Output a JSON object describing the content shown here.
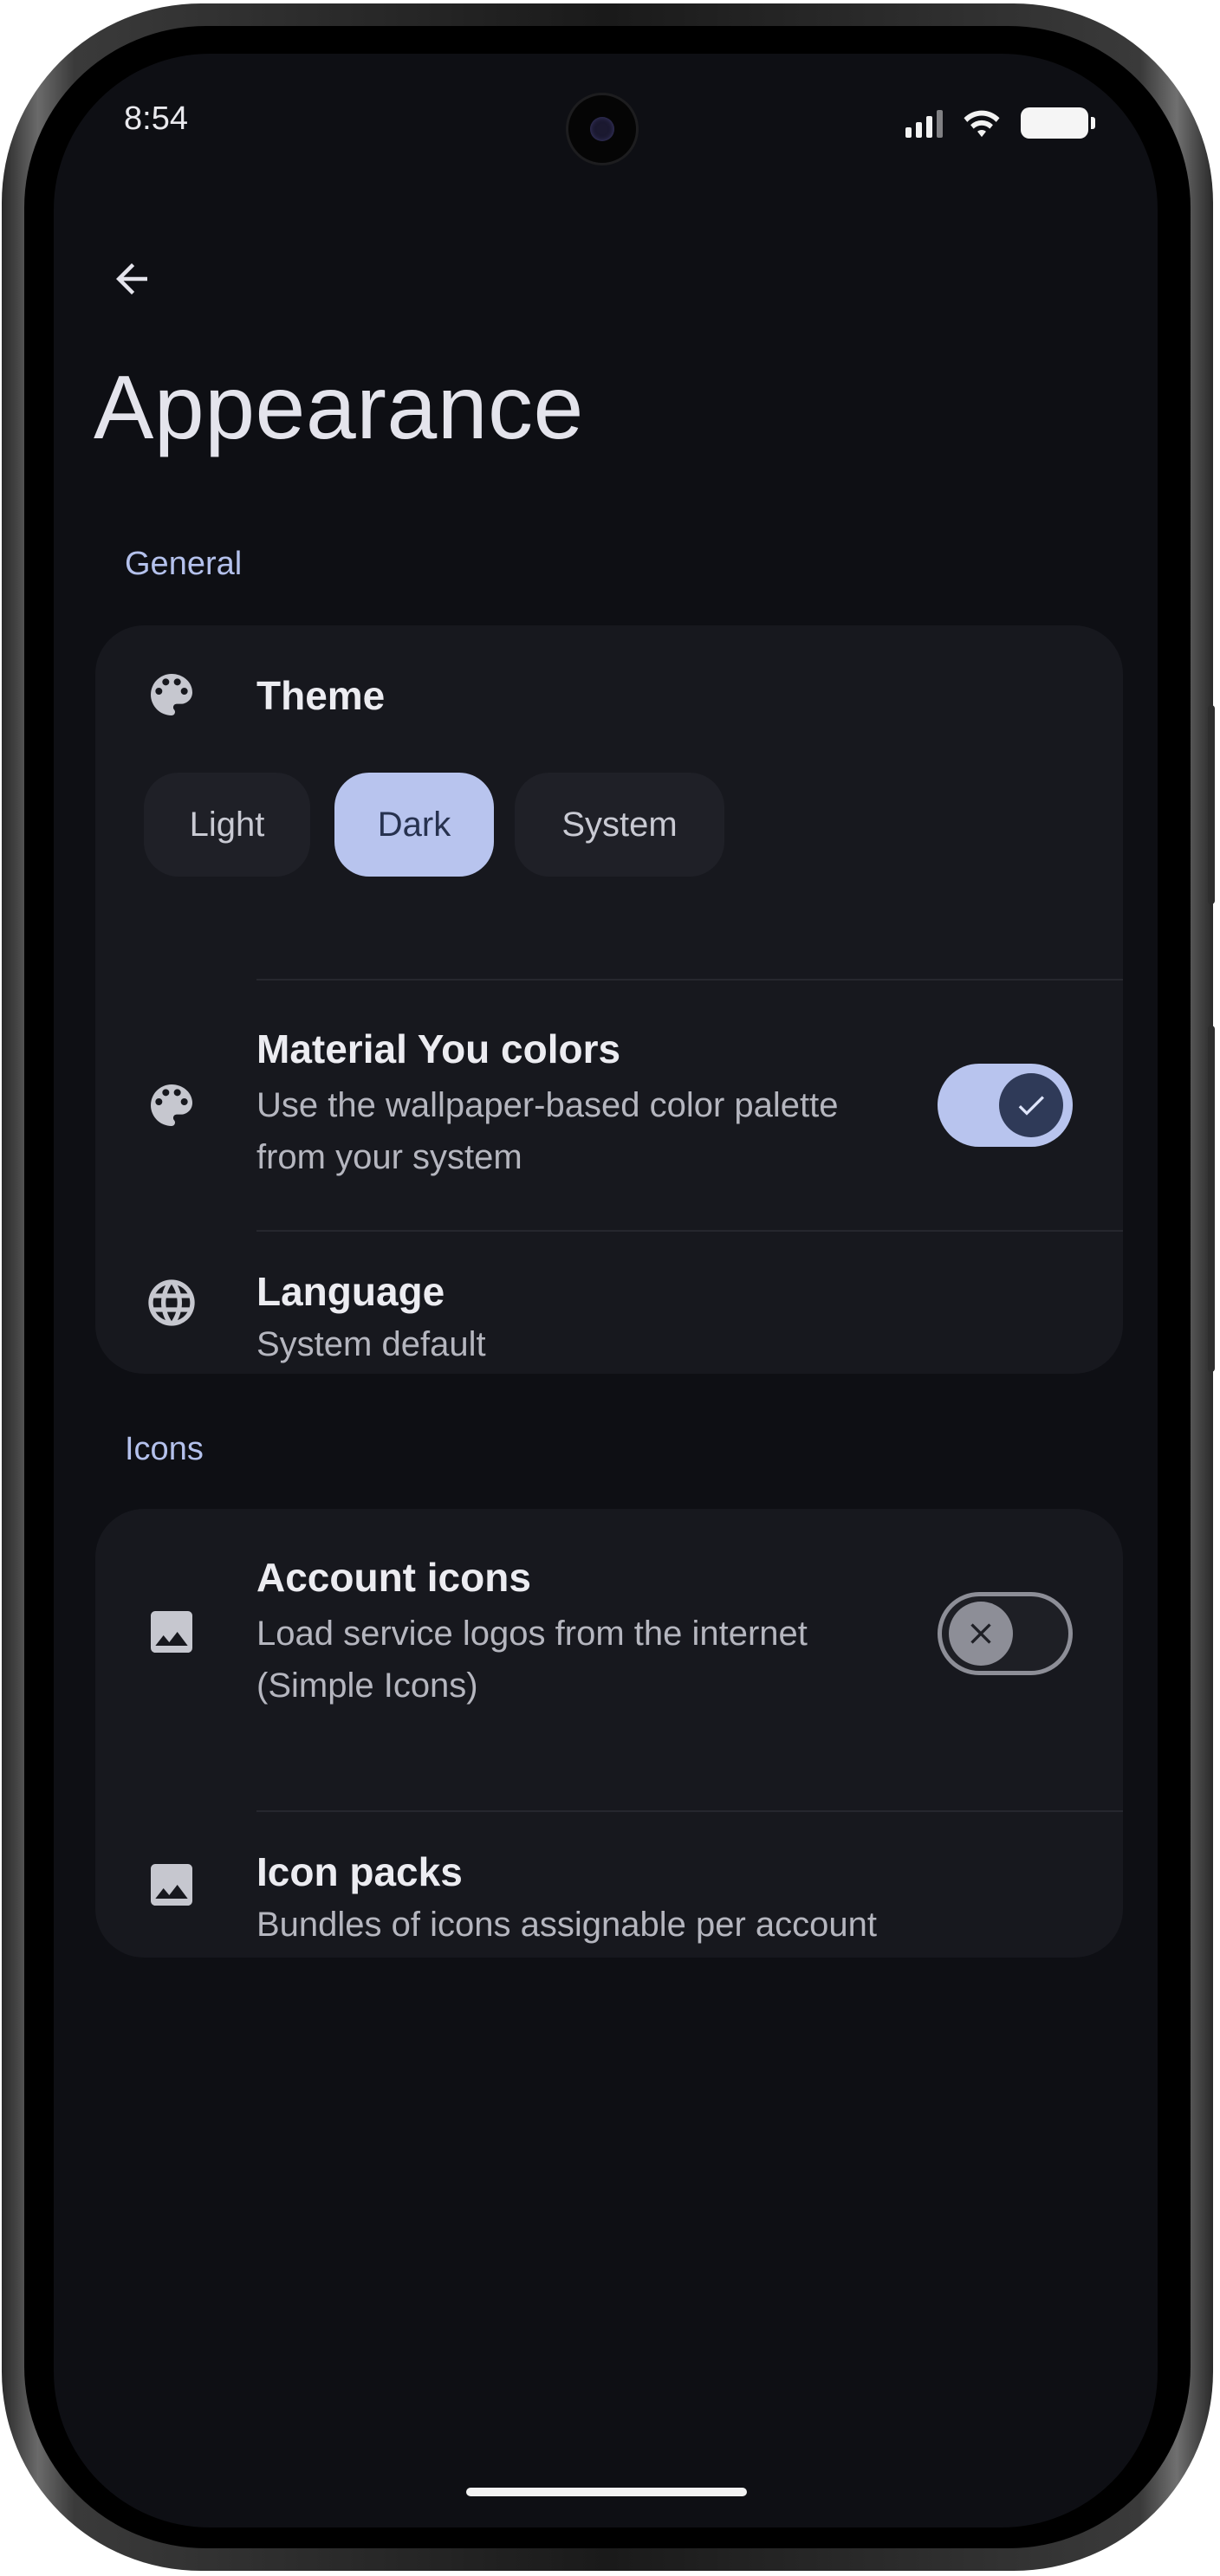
{
  "status_bar": {
    "time": "8:54"
  },
  "page": {
    "title": "Appearance"
  },
  "sections": {
    "general": {
      "label": "General",
      "theme": {
        "title": "Theme",
        "options": [
          "Light",
          "Dark",
          "System"
        ],
        "selected": "Dark"
      },
      "material_you": {
        "title": "Material You colors",
        "subtitle_line1": "Use the wallpaper-based color palette",
        "subtitle_line2": "from your system",
        "enabled": true
      },
      "language": {
        "title": "Language",
        "subtitle": "System default"
      }
    },
    "icons": {
      "label": "Icons",
      "account_icons": {
        "title": "Account icons",
        "subtitle_line1": "Load service logos from the internet",
        "subtitle_line2": "(Simple Icons)",
        "enabled": false
      },
      "icon_packs": {
        "title": "Icon packs",
        "subtitle": "Bundles of icons assignable per account"
      }
    }
  },
  "icons": {
    "back": "arrow-back-icon",
    "theme": "palette-icon",
    "material_you": "palette-icon",
    "language": "globe-icon",
    "account_icons": "image-icon",
    "icon_packs": "image-icon"
  },
  "colors": {
    "background": "#0e0f14",
    "card": "#17181e",
    "accent": "#b8c4ee",
    "section_label": "#b4c1ec"
  }
}
